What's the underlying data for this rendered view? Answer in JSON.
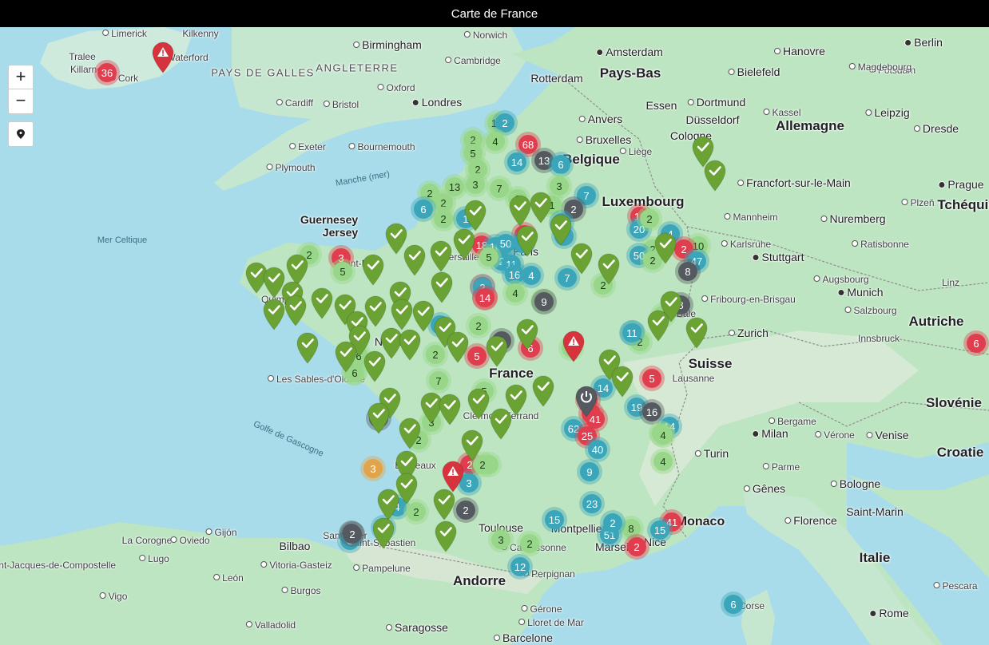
{
  "title": "Carte de France",
  "controls": {
    "zoom_in": "+",
    "zoom_out": "−",
    "locate_icon": "location-pin-icon"
  },
  "colors": {
    "green": "#98d68a",
    "blue": "#3ba5ba",
    "red": "#e03e4e",
    "grey": "#555a60",
    "orange": "#e2a44a",
    "check_pin": "#6aa333",
    "alert_pin": "#d7333d",
    "power_pin": "#555a60"
  },
  "countries": [
    "PAYS DE GALLES",
    "ANGLETERRE",
    "Pays-Bas",
    "Belgique",
    "Luxembourg",
    "Allemagne",
    "Tchéquie",
    "France",
    "Suisse",
    "Autriche",
    "Slovénie",
    "Croatie",
    "Italie",
    "Andorre",
    "Monaco",
    "Saint-Marin",
    "Guernesey",
    "Jersey"
  ],
  "seas": [
    "Manche (mer)",
    "Mer Celtique",
    "Golfe de Gascogne"
  ],
  "cities": [
    "Limerick",
    "Kilkenny",
    "Waterford",
    "Tralee",
    "Killarney",
    "Cork",
    "Birmingham",
    "Norwich",
    "Cambridge",
    "Oxford",
    "Londres",
    "Cardiff",
    "Bristol",
    "Exeter",
    "Bournemouth",
    "Plymouth",
    "Amsterdam",
    "Rotterdam",
    "Anvers",
    "Bruxelles",
    "Liège",
    "Berlin",
    "Hanovre",
    "Potsdam",
    "Magdebourg",
    "Bielefeld",
    "Dortmund",
    "Essen",
    "Düsseldorf",
    "Cologne",
    "Kassel",
    "Leipzig",
    "Dresde",
    "Prague",
    "Francfort-sur-le-Main",
    "Mannheim",
    "Nuremberg",
    "Plzeň",
    "Karlsruhe",
    "Stuttgart",
    "Ratisbonne",
    "Augsbourg",
    "Munich",
    "Linz",
    "Fribourg-en-Brisgau",
    "Salzbourg",
    "Bâle",
    "Zurich",
    "Innsbruck",
    "Lausanne",
    "Nantes",
    "Paris",
    "Versailles",
    "Saint-Malo",
    "Quimper",
    "Les Sables-d'Olonne",
    "Clermont-Ferrand",
    "Bordeaux",
    "Toulouse",
    "Carcassonne",
    "Perpignan",
    "Montpellier",
    "Marseille",
    "Nice",
    "Bergame",
    "Milan",
    "Vérone",
    "Venise",
    "Turin",
    "Parme",
    "Gênes",
    "Bologne",
    "Florence",
    "Pescara",
    "Rome",
    "La Corogne",
    "Lugo",
    "Oviedo",
    "Gijón",
    "Santander",
    "Bilbao",
    "Vitoria-Gasteiz",
    "Pampelune",
    "Saint-Jacques-de-Compostelle",
    "León",
    "Burgos",
    "Vigo",
    "Valladolid",
    "Saragosse",
    "Gérone",
    "Lloret de Mar",
    "Barcelone",
    "Corse",
    "Saint-Sébastien"
  ],
  "clusters": [
    {
      "v": "36",
      "c": "red"
    },
    {
      "v": "15",
      "c": "green"
    },
    {
      "v": "2",
      "c": "blue"
    },
    {
      "v": "2",
      "c": "green"
    },
    {
      "v": "4",
      "c": "green"
    },
    {
      "v": "5",
      "c": "green"
    },
    {
      "v": "68",
      "c": "red"
    },
    {
      "v": "2",
      "c": "green"
    },
    {
      "v": "14",
      "c": "blue"
    },
    {
      "v": "13",
      "c": "grey"
    },
    {
      "v": "6",
      "c": "blue"
    },
    {
      "v": "2",
      "c": "green"
    },
    {
      "v": "13",
      "c": "green"
    },
    {
      "v": "3",
      "c": "green"
    },
    {
      "v": "7",
      "c": "green"
    },
    {
      "v": "2",
      "c": "green"
    },
    {
      "v": "3",
      "c": "green"
    },
    {
      "v": "7",
      "c": "blue"
    },
    {
      "v": "2",
      "c": "grey"
    },
    {
      "v": "1",
      "c": "green"
    },
    {
      "v": "2",
      "c": "green"
    },
    {
      "v": "6",
      "c": "blue"
    },
    {
      "v": "2",
      "c": "green"
    },
    {
      "v": "1",
      "c": "blue"
    },
    {
      "v": "14",
      "c": "blue"
    },
    {
      "v": "10",
      "c": "red"
    },
    {
      "v": "20",
      "c": "blue"
    },
    {
      "v": "2",
      "c": "green"
    },
    {
      "v": "2",
      "c": "red"
    },
    {
      "v": "7",
      "c": "blue"
    },
    {
      "v": "4",
      "c": "blue"
    },
    {
      "v": "10",
      "c": "green"
    },
    {
      "v": "2",
      "c": "red"
    },
    {
      "v": "47",
      "c": "blue"
    },
    {
      "v": "2",
      "c": "green"
    },
    {
      "v": "50",
      "c": "blue"
    },
    {
      "v": "8",
      "c": "grey"
    },
    {
      "v": "2",
      "c": "green"
    },
    {
      "v": "8",
      "c": "grey"
    },
    {
      "v": "4",
      "c": "green"
    },
    {
      "v": "11",
      "c": "blue"
    },
    {
      "v": "2",
      "c": "green"
    },
    {
      "v": "14",
      "c": "red"
    },
    {
      "v": "5",
      "c": "red"
    },
    {
      "v": "9",
      "c": "green"
    },
    {
      "v": "3",
      "c": "red"
    },
    {
      "v": "5",
      "c": "green"
    },
    {
      "v": "2",
      "c": "green"
    },
    {
      "v": "18",
      "c": "red"
    },
    {
      "v": "18",
      "c": "blue"
    },
    {
      "v": "50",
      "c": "blue"
    },
    {
      "v": "5",
      "c": "blue"
    },
    {
      "v": "2",
      "c": "blue"
    },
    {
      "v": "11",
      "c": "blue"
    },
    {
      "v": "5",
      "c": "green"
    },
    {
      "v": "16",
      "c": "blue"
    },
    {
      "v": "4",
      "c": "blue"
    },
    {
      "v": "7",
      "c": "blue"
    },
    {
      "v": "2",
      "c": "green"
    },
    {
      "v": "2",
      "c": "blue"
    },
    {
      "v": "14",
      "c": "red"
    },
    {
      "v": "4",
      "c": "green"
    },
    {
      "v": "9",
      "c": "grey"
    },
    {
      "v": "17",
      "c": "blue"
    },
    {
      "v": "2",
      "c": "green"
    },
    {
      "v": "6",
      "c": "grey"
    },
    {
      "v": "6",
      "c": "red"
    },
    {
      "v": "2",
      "c": "green"
    },
    {
      "v": "5",
      "c": "red"
    },
    {
      "v": "2",
      "c": "green"
    },
    {
      "v": "6",
      "c": "green"
    },
    {
      "v": "6",
      "c": "green"
    },
    {
      "v": "7",
      "c": "green"
    },
    {
      "v": "4",
      "c": "grey"
    },
    {
      "v": "3",
      "c": "green"
    },
    {
      "v": "2",
      "c": "green"
    },
    {
      "v": "2",
      "c": "red"
    },
    {
      "v": "5",
      "c": "green"
    },
    {
      "v": "14",
      "c": "blue"
    },
    {
      "v": "16",
      "c": "red"
    },
    {
      "v": "45",
      "c": "red"
    },
    {
      "v": "41",
      "c": "red"
    },
    {
      "v": "62",
      "c": "blue"
    },
    {
      "v": "25",
      "c": "red"
    },
    {
      "v": "40",
      "c": "blue"
    },
    {
      "v": "19",
      "c": "blue"
    },
    {
      "v": "16",
      "c": "grey"
    },
    {
      "v": "14",
      "c": "blue"
    },
    {
      "v": "5",
      "c": "red"
    },
    {
      "v": "11",
      "c": "blue"
    },
    {
      "v": "2",
      "c": "green"
    },
    {
      "v": "3",
      "c": "orange"
    },
    {
      "v": "4",
      "c": "blue"
    },
    {
      "v": "3",
      "c": "blue"
    },
    {
      "v": "2",
      "c": "grey"
    },
    {
      "v": "2",
      "c": "green"
    },
    {
      "v": "11",
      "c": "blue"
    },
    {
      "v": "2",
      "c": "grey"
    },
    {
      "v": "8",
      "c": "green"
    },
    {
      "v": "23",
      "c": "blue"
    },
    {
      "v": "51",
      "c": "blue"
    },
    {
      "v": "2",
      "c": "blue"
    },
    {
      "v": "41",
      "c": "red"
    },
    {
      "v": "15",
      "c": "blue"
    },
    {
      "v": "2",
      "c": "red"
    },
    {
      "v": "15",
      "c": "blue"
    },
    {
      "v": "12",
      "c": "blue"
    },
    {
      "v": "2",
      "c": "green"
    },
    {
      "v": "6",
      "c": "blue"
    },
    {
      "v": "6",
      "c": "red"
    },
    {
      "v": "4",
      "c": "green"
    },
    {
      "v": "3",
      "c": "green"
    },
    {
      "v": "2",
      "c": "green"
    },
    {
      "v": "3",
      "c": "blue"
    },
    {
      "v": "2",
      "c": "grey"
    },
    {
      "v": "4",
      "c": "green"
    },
    {
      "v": "9",
      "c": "blue"
    },
    {
      "v": "2",
      "c": "green"
    },
    {
      "v": "6",
      "c": "green"
    }
  ],
  "pins": [
    {
      "type": "alert"
    },
    {
      "type": "alert"
    },
    {
      "type": "alert"
    },
    {
      "type": "power"
    },
    {
      "type": "check"
    },
    {
      "type": "check"
    },
    {
      "type": "check"
    },
    {
      "type": "check"
    },
    {
      "type": "check"
    },
    {
      "type": "check"
    },
    {
      "type": "check"
    },
    {
      "type": "check"
    },
    {
      "type": "check"
    },
    {
      "type": "check"
    },
    {
      "type": "check"
    },
    {
      "type": "check"
    },
    {
      "type": "check"
    },
    {
      "type": "check"
    },
    {
      "type": "check"
    },
    {
      "type": "check"
    },
    {
      "type": "check"
    },
    {
      "type": "check"
    },
    {
      "type": "check"
    },
    {
      "type": "check"
    },
    {
      "type": "check"
    },
    {
      "type": "check"
    },
    {
      "type": "check"
    },
    {
      "type": "check"
    },
    {
      "type": "check"
    },
    {
      "type": "check"
    },
    {
      "type": "check"
    },
    {
      "type": "check"
    },
    {
      "type": "check"
    },
    {
      "type": "check"
    },
    {
      "type": "check"
    },
    {
      "type": "check"
    },
    {
      "type": "check"
    },
    {
      "type": "check"
    },
    {
      "type": "check"
    },
    {
      "type": "check"
    },
    {
      "type": "check"
    },
    {
      "type": "check"
    },
    {
      "type": "check"
    },
    {
      "type": "check"
    },
    {
      "type": "check"
    },
    {
      "type": "check"
    },
    {
      "type": "check"
    },
    {
      "type": "check"
    },
    {
      "type": "check"
    },
    {
      "type": "check"
    },
    {
      "type": "check"
    },
    {
      "type": "check"
    },
    {
      "type": "check"
    },
    {
      "type": "check"
    },
    {
      "type": "check"
    },
    {
      "type": "check"
    },
    {
      "type": "check"
    },
    {
      "type": "check"
    },
    {
      "type": "check"
    },
    {
      "type": "check"
    },
    {
      "type": "check"
    },
    {
      "type": "check"
    },
    {
      "type": "check"
    },
    {
      "type": "check"
    }
  ]
}
